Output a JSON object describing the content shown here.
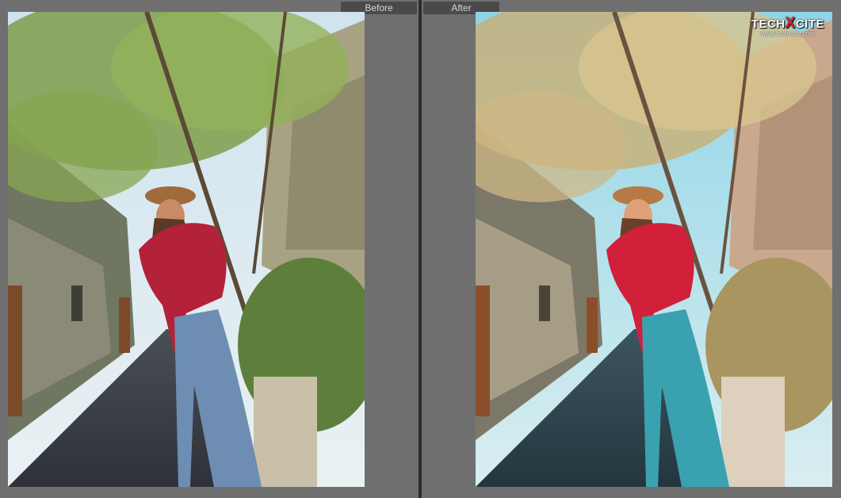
{
  "panes": {
    "before_label": "Before",
    "after_label": "After"
  },
  "watermark": {
    "brand_left": "TECH",
    "brand_x": "X",
    "brand_right": "CITE",
    "url": "www.techxcite.com"
  },
  "colors": {
    "background": "#6e6e6e",
    "divider": "#2c2c2c",
    "label_bg": "#4a4a4a",
    "watermark_accent": "#e02020"
  }
}
